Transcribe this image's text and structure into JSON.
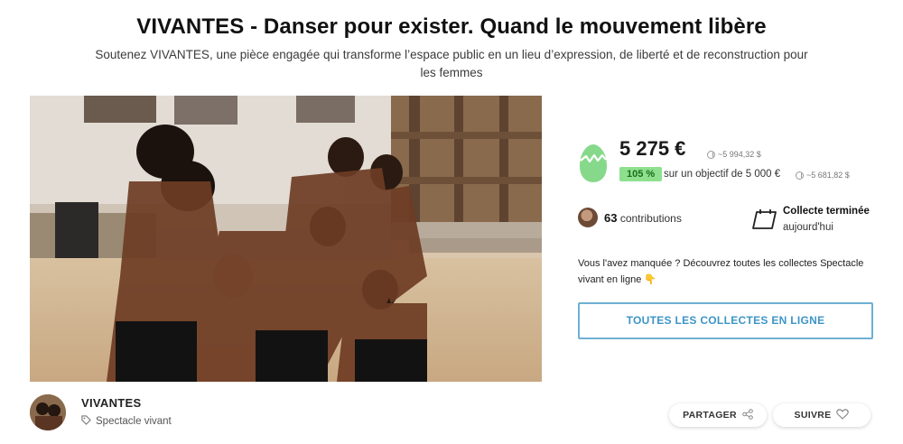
{
  "header": {
    "title": "VIVANTES - Danser pour exister. Quand le mouvement libère",
    "subtitle": "Soutenez VIVANTES, une pièce engagée qui transforme l’espace public en un lieu d’expression, de liberté et de reconstruction pour les femmes"
  },
  "owner": {
    "name": "VIVANTES",
    "category": "Spectacle vivant"
  },
  "funding": {
    "amount": "5 275 €",
    "amount_converted": "~5 994,32 $",
    "percent": "105 %",
    "goal_text": "sur un objectif de 5 000 €",
    "goal_converted": "~5 681,82 $",
    "progress_fraction": 1.055
  },
  "contributions": {
    "count": "63",
    "label": "contributions"
  },
  "status": {
    "title": "Collecte terminée",
    "subtitle": "aujourd'hui"
  },
  "missed": {
    "text": "Vous l'avez manquée ? Découvrez toutes les collectes Spectacle vivant en ligne 👇"
  },
  "actions": {
    "all_button": "TOUTES LES COLLECTES EN LIGNE",
    "share": "PARTAGER",
    "follow": "SUIVRE"
  },
  "icons": {
    "egg": "broken-egg-icon",
    "calendar": "calendar-icon",
    "tag": "tag-icon",
    "share": "share-icon",
    "heart": "heart-icon",
    "coin": "coin-icon"
  },
  "colors": {
    "accent_blue": "#3d95c6",
    "success_green": "#8ee08e",
    "egg_green": "#86d98a"
  }
}
